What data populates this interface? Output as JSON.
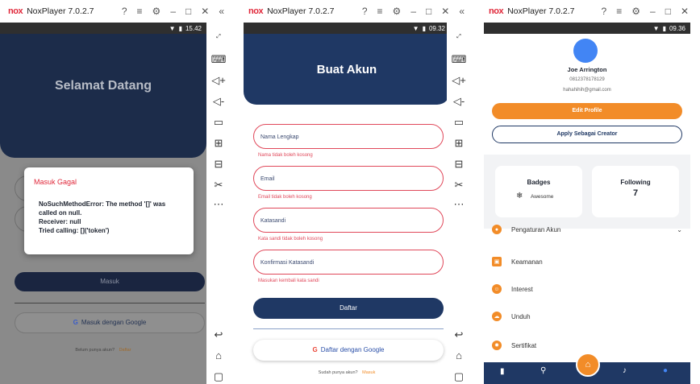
{
  "windows": [
    {
      "app_name": "NoxPlayer 7.0.2.7",
      "status_time": "15.42",
      "welcome_title": "Selamat Datang",
      "dialog": {
        "title": "Masuk Gagal",
        "message": "NoSuchMethodError: The method '[]' was called on null.\nReceiver: null\nTried calling: []('token')"
      },
      "login_button": "Masuk",
      "google_button": "Masuk dengan Google",
      "no_account": "Belum punya akun?",
      "register_link": "Daftar"
    },
    {
      "app_name": "NoxPlayer 7.0.2.7",
      "status_time": "09.32",
      "title": "Buat Akun",
      "fields": [
        {
          "placeholder": "Nama Lengkap",
          "error": "Nama tidak boleh kosong"
        },
        {
          "placeholder": "Email",
          "error": "Email tidak boleh kosong"
        },
        {
          "placeholder": "Katasandi",
          "error": "Kata sandi tidak boleh kosong"
        },
        {
          "placeholder": "Konfirmasi Katasandi",
          "error": "Masukan kembali kata sandi"
        }
      ],
      "register_button": "Daftar",
      "google_button": "Daftar dengan Google",
      "have_account": "Sudah punya akun?",
      "login_link": "Masuk"
    },
    {
      "app_name": "NoxPlayer 7.0.2.7",
      "status_time": "09.36",
      "profile": {
        "name": "Joe Arrington",
        "phone": "0812378178129",
        "email": "hahahihih@gmail.com"
      },
      "edit_profile": "Edit Profile",
      "apply_creator": "Apply Sebagai Creator",
      "badges": {
        "title": "Badges",
        "item": "Awesome"
      },
      "following": {
        "title": "Following",
        "count": "7"
      },
      "menu": [
        {
          "label": "Pengaturan Akun",
          "icon": "user-icon"
        },
        {
          "label": "Keamanan",
          "icon": "lock-icon"
        },
        {
          "label": "Interest",
          "icon": "smile-icon"
        },
        {
          "label": "Unduh",
          "icon": "cloud-download-icon"
        },
        {
          "label": "Sertifikat",
          "icon": "badge-icon"
        }
      ]
    }
  ],
  "colors": {
    "navy": "#1f3864",
    "orange": "#f28c28",
    "error": "#e0485a",
    "profile_blue": "#4285f4",
    "nox_red": "#e0283a"
  }
}
